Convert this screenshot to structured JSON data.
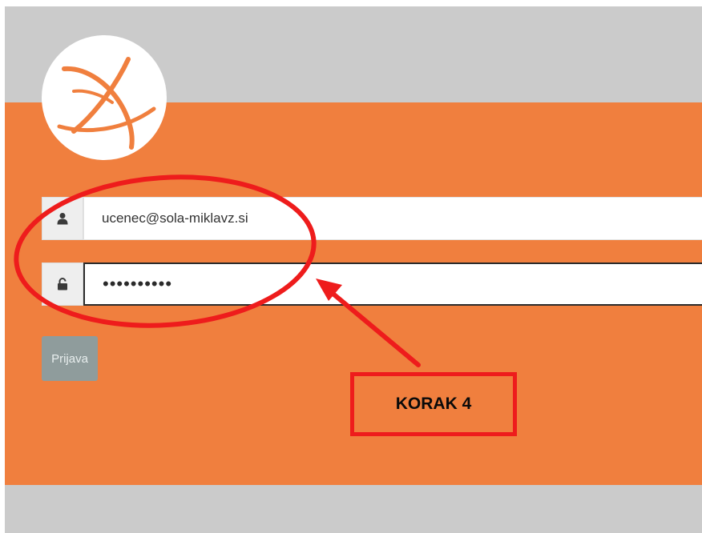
{
  "login_form": {
    "username_value": "ucenec@sola-miklavz.si",
    "password_masked": "••••••••••",
    "submit_label": "Prijava"
  },
  "icons": {
    "logo": "school-logo-icon",
    "user": "user-icon",
    "lock": "lock-icon"
  },
  "annotation": {
    "step_label": "KORAK 4"
  },
  "colors": {
    "brand_orange": "#f07f3e",
    "background_gray": "#cbcbcb",
    "annotation_red": "#ee1c1c",
    "button_gray": "#8f9c9c"
  }
}
